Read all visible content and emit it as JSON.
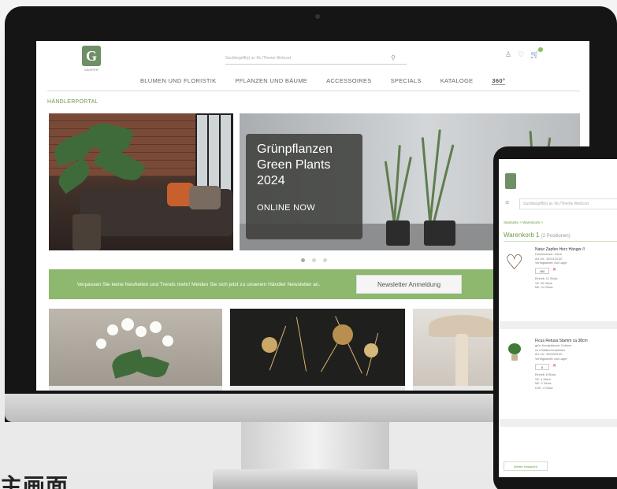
{
  "site": {
    "logo_text": "G",
    "logo_sub": "GASPER",
    "search_placeholder": "Suchbegriff(e) ar.-Nr./Theme Webcod",
    "nav": [
      "BLUMEN UND FLORISTIK",
      "PFLANZEN UND BÄUME",
      "ACCESSOIRES",
      "SPECIALS",
      "KATALOGE",
      "360°"
    ],
    "breadcrumb": "HÄNDLERPORTAL",
    "promo": {
      "title_line1": "Grünpflanzen",
      "title_line2": "Green Plants",
      "title_line3": "2024",
      "cta": "ONLINE NOW"
    },
    "newsletter": {
      "text": "Verpassen Sie keine Neuheiten und Trends mehr! Melden Sie sich jetzt zu unserem Händler Newsletter an.",
      "button": "Newsletter Anmeldung"
    }
  },
  "tablet": {
    "search_placeholder": "Suchbegriff(e) ar.-Nr./Theme Webcod",
    "breadcrumb": "Startseite > Warenkorb >",
    "cart_title": "Warenkorb 1",
    "cart_count": "(2 Positionen)",
    "items": [
      {
        "name": "Natur Zapfen Herz Hänger //",
        "meta": [
          "Durchmesser: 34cm",
          "Art.-Nr.: 3020124-00",
          "Verfügbarkeit: Auf Lager"
        ],
        "qty": "480",
        "stock": [
          "Einheit: 12 Stück",
          "VE: 96 Stück",
          "ME: 24 Stück"
        ]
      },
      {
        "name": "Ficus Retusa Stamm ca 38cm",
        "meta": [
          "grün Kunstpflanze/ Outdoor",
          "ca 9 Blätter/Grasfelder",
          "Art.-Nr.: 3020033-00",
          "Verfügbarkeit: Auf Lager"
        ],
        "qty": "8",
        "stock": [
          "Einheit: 8 Stück",
          "VE: 4 Stück",
          "ME: 2 Stück",
          "UVE: 4 Stück"
        ]
      }
    ],
    "continue_button": "Weiter einkaufen"
  },
  "corner_text": "主画面",
  "colors": {
    "brand_green": "#8db86e",
    "accent_green": "#6a9a4a",
    "promo_box": "#3c3e3a"
  }
}
